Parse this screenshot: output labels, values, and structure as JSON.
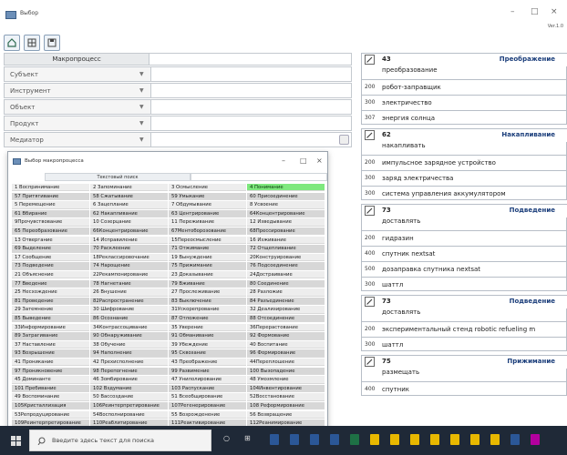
{
  "window": {
    "title": "Выбор",
    "version": "Ver.1.0",
    "minimize": "–",
    "maximize": "□",
    "close": "×"
  },
  "toolbar": {
    "icons": [
      "home-icon",
      "grid-icon",
      "save-icon"
    ]
  },
  "left": {
    "header": "Макропроцесс",
    "rows": [
      {
        "label": "Субъект",
        "arrow": "▼"
      },
      {
        "label": "Инструмент",
        "arrow": "▼"
      },
      {
        "label": "Объект",
        "arrow": "▼"
      },
      {
        "label": "Продукт",
        "arrow": "▼"
      },
      {
        "label": "Медиатор",
        "arrow": "▼"
      }
    ]
  },
  "dialog": {
    "title": "Выбор макропроцесса",
    "search_label": "Текстовый поиск",
    "minimize": "–",
    "maximize": "□",
    "close": "×",
    "columns": [
      [
        "1 Восприниманиe",
        "57 Притягивание",
        "5 Перемещение",
        "61 Вбирание",
        "9Прочувствование",
        "65 Переобразование",
        "13 Отвергание",
        "69 Выделение",
        "17 Сообщение",
        "73 Подведение",
        "21 Объяснение",
        "77 Введение",
        "25 Несхождение",
        "81 Проведение",
        "29 Затемнение",
        "85 Выведение",
        "33Информирование",
        "89 Затрагивание",
        "37 Наставление",
        "93 Возрышение",
        "41 Проникание",
        "97 Проникновение",
        "45 Доминанте",
        "101 Пребивание",
        "49 Воспоминание",
        "105Кристаллизация",
        "53Репродуцирование",
        "109Реинтерпретирование"
      ],
      [
        "2 Запоминание",
        "58 Сжатывание",
        "6 Зацеплание",
        "62 Накапливание",
        "10 Созерцание",
        "66Концентрирование",
        "14 Исправиление",
        "70 Расклеение",
        "18Реклассировочание",
        "74 Нарощение",
        "22Рекампонирование",
        "78 Нагнетание",
        "26 Внушение",
        "82Распространение",
        "30 Шифрование",
        "86 Осознание",
        "34Контрассоцивание",
        "90 Обнаруживание",
        "38 Обучение",
        "94 Наполнение",
        "42 Прехисполнение",
        "98 Перепогнение",
        "46 Зомбирование",
        "102 Вздумание",
        "50 Вассоздание",
        "106Реинтерпретирование",
        "54Восполнирование",
        "110Реаблитирование"
      ],
      [
        "3 Осмысление",
        "59 Умыкание",
        "7 Обдумывание",
        "63 Центрирование",
        "11 Переживание",
        "67Ментоборозование",
        "15Переосмысление",
        "71 Отжимание",
        "19 Вынуждение",
        "75 Прижимание",
        "23 Доказывание",
        "79 Вживание",
        "27 Прослеживание",
        "83 Выключение",
        "31Ускорепрование",
        "87 Отложение",
        "35 Уверение",
        "91 Обманивание",
        "39 Убеждение",
        "95 Сквозание",
        "43 Преображение",
        "99 Развимение",
        "47 Унилолирование",
        "103 Распускание",
        "51 Всеобщирование",
        "107Регенерирование",
        "55 Возрожденение",
        "111Реактивирование"
      ],
      [
        "4 Понимание",
        "60 Присоединение",
        "8 Усвоение",
        "64Концентрирование",
        "12 Изведывание",
        "68Прессирование",
        "16 Изживание",
        "72 Отщепливание",
        "20Конструирование",
        "76 Подсоединение",
        "24Достраивание",
        "80 Соединение",
        "28 Разложие",
        "84 Разъединение",
        "32 Деализирование",
        "88 Отсоединение",
        "36Перерастование",
        "92 Формование",
        "40 Воспитание",
        "96 Формирование",
        "44Переплошение",
        "100 Вызопадение",
        "48 Умозмление",
        "104Инвентирование",
        "52Восстанование",
        "108 Реформирование",
        "56 Возвращение",
        "112Реанимирование"
      ]
    ],
    "selected": "4 Понимание"
  },
  "cards": [
    {
      "num": "43",
      "name": "Преображение",
      "sub": "преобразование",
      "rows": [
        {
          "n": "200",
          "t": "робот-заправщик"
        },
        {
          "n": "300",
          "t": "электричество"
        },
        {
          "n": "307",
          "t": "энергия солнца"
        }
      ]
    },
    {
      "num": "62",
      "name": "Накапливание",
      "sub": "накапливать",
      "rows": [
        {
          "n": "200",
          "t": "импульсное зарядное устройство"
        },
        {
          "n": "300",
          "t": "заряд электричества"
        },
        {
          "n": "300",
          "t": "система управления аккумулятором"
        }
      ]
    },
    {
      "num": "73",
      "name": "Подведение",
      "sub": "доставлять",
      "rows": [
        {
          "n": "200",
          "t": "гидразин"
        },
        {
          "n": "400",
          "t": "спутник nextsat"
        },
        {
          "n": "500",
          "t": "дозаправка спутника nextsat"
        },
        {
          "n": "300",
          "t": "шаттл"
        }
      ]
    },
    {
      "num": "73",
      "name": "Подведение",
      "sub": "доставлять",
      "rows": [
        {
          "n": "200",
          "t": "экспериментальный стенд robotic refueling m"
        },
        {
          "n": "300",
          "t": "шаттл"
        }
      ]
    },
    {
      "num": "75",
      "name": "Прижимание",
      "sub": "размещать",
      "rows": [
        {
          "n": "400",
          "t": "спутник"
        }
      ]
    }
  ],
  "taskbar": {
    "search_placeholder": "Введите здесь текст для поиска",
    "accent": "#1f2937"
  }
}
